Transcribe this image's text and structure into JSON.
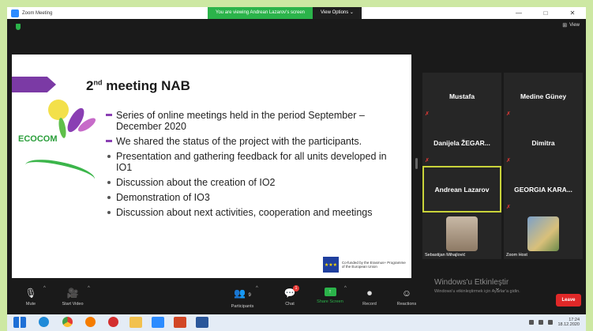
{
  "window": {
    "title": "Zoom Meeting",
    "banner": "You are viewing Andrean Lazarov's screen",
    "view_options": "View Options",
    "min": "—",
    "max": "□",
    "close": "✕"
  },
  "meeting": {
    "view_label": "View"
  },
  "slide": {
    "title_prefix": "2",
    "title_sup": "nd",
    "title_rest": "meeting NAB",
    "logo_text": "ECOCOM",
    "bullets": [
      "Series of online meetings held in the period September – December 2020",
      "We shared the status of the project with the participants.",
      "Presentation and gathering feedback for all units developed in IO1",
      "Discussion about the creation of IO2",
      "Demonstration of IO3",
      "Discussion about next activities, cooperation and meetings"
    ],
    "erasmus_text": "Co-funded by the Erasmus+ Programme of the European Union"
  },
  "participants": [
    {
      "name": "Mustafa"
    },
    {
      "name": "Medine Güney"
    },
    {
      "name": "Danijela ŽEGAR..."
    },
    {
      "name": "Dimitra"
    },
    {
      "name": "Andrean Lazarov"
    },
    {
      "name": "GEORGIA KARA..."
    },
    {
      "name": "Sebastijan Mihajlović"
    },
    {
      "name": "Zoom Host"
    }
  ],
  "toolbar": {
    "mute": "Mute",
    "start_video": "Start Video",
    "participants": "Participants",
    "participants_count": "9",
    "chat": "Chat",
    "chat_badge": "1",
    "share_screen": "Share Screen",
    "record": "Record",
    "reactions": "Reactions",
    "leave": "Leave"
  },
  "activation": {
    "title": "Windows'u Etkinleştir",
    "subtitle": "Windows'u etkinleştirmek için Ayarlar'a gidin."
  },
  "taskbar": {
    "time": "17:24",
    "date": "18.12.2020"
  },
  "colors": {
    "accent_green": "#2bb34a",
    "slide_purple": "#7b3aa5",
    "leave_red": "#e02828",
    "active_border": "#c9d33a"
  }
}
